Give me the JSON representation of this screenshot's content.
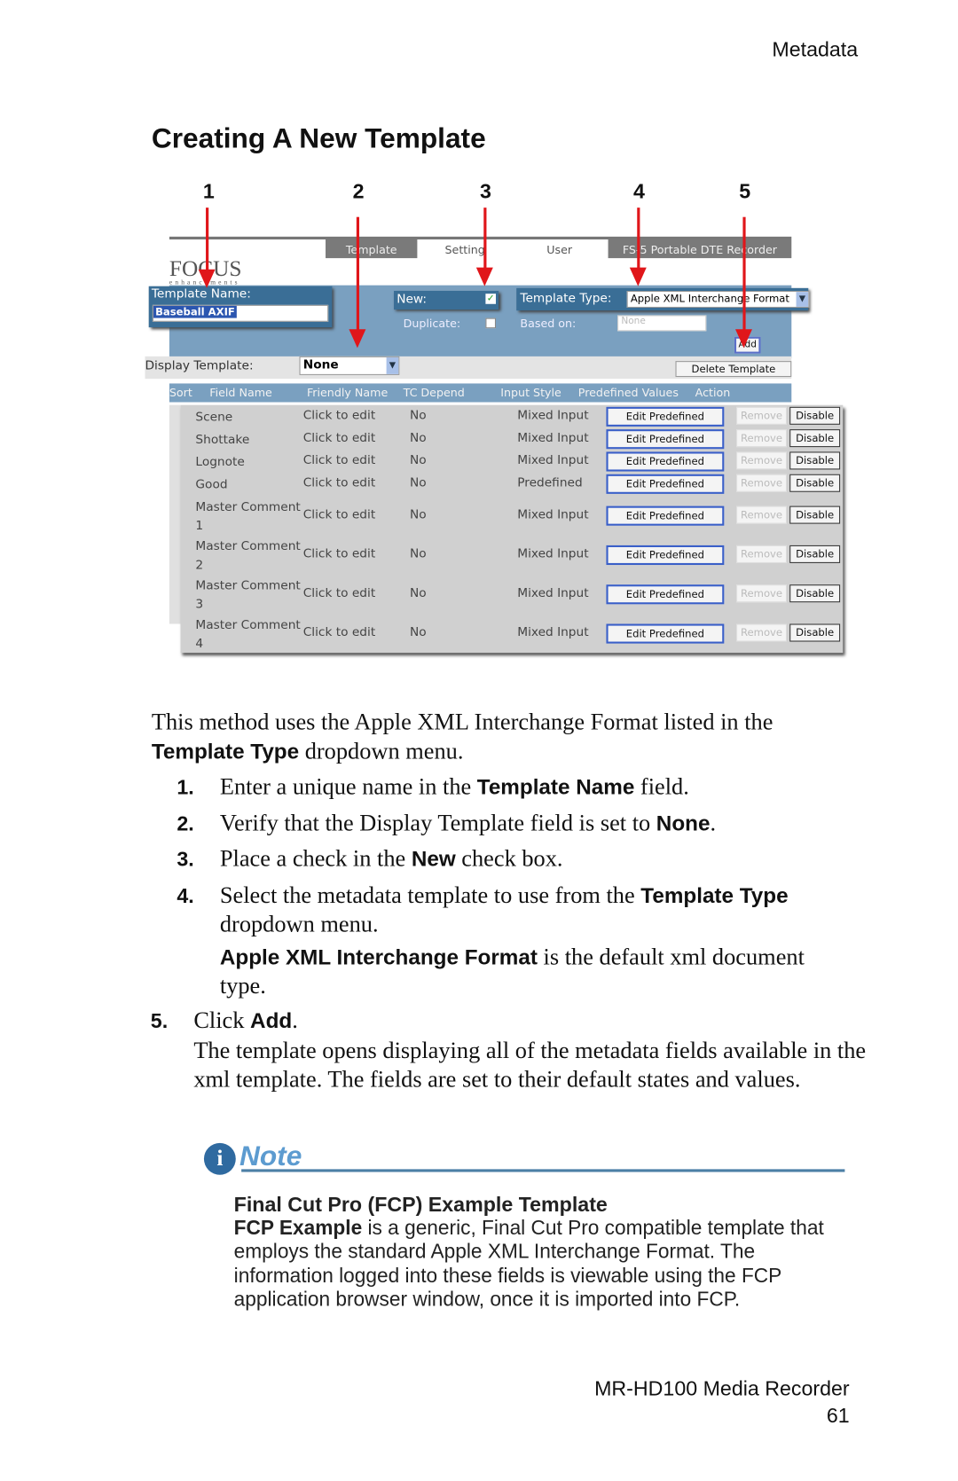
{
  "header": {
    "section": "Metadata"
  },
  "title": "Creating A New Template",
  "callouts": [
    "1",
    "2",
    "3",
    "4",
    "5"
  ],
  "screenshot": {
    "tabs": [
      "Template",
      "Setting",
      "User",
      "FS-5 Portable DTE Recorder"
    ],
    "logo": "FOCUS",
    "logo_sub": "enhancements",
    "template_name_label": "Template Name:",
    "template_name_value": "Baseball AXIF",
    "new_label": "New:",
    "new_checked": true,
    "duplicate_label": "Duplicate:",
    "duplicate_checked": false,
    "template_type_label": "Template Type:",
    "template_type_value": "Apple XML Interchange Format",
    "based_on_label": "Based on:",
    "based_on_value": "None",
    "add_button": "Add",
    "display_template_label": "Display Template:",
    "display_template_value": "None",
    "delete_button": "Delete Template",
    "columns": [
      "Sort",
      "Field Name",
      "Friendly Name",
      "TC Depend",
      "Input Style",
      "Predefined Values",
      "Action"
    ],
    "rows": [
      {
        "field": "Scene",
        "friendly": "Click to edit",
        "tc": "No",
        "style": "Mixed Input"
      },
      {
        "field": "Shottake",
        "friendly": "Click to edit",
        "tc": "No",
        "style": "Mixed Input"
      },
      {
        "field": "Lognote",
        "friendly": "Click to edit",
        "tc": "No",
        "style": "Mixed Input"
      },
      {
        "field": "Good",
        "friendly": "Click to edit",
        "tc": "No",
        "style": "Predefined"
      },
      {
        "field": "Master Comment 1",
        "friendly": "Click to edit",
        "tc": "No",
        "style": "Mixed Input"
      },
      {
        "field": "Master Comment 2",
        "friendly": "Click to edit",
        "tc": "No",
        "style": "Mixed Input"
      },
      {
        "field": "Master Comment 3",
        "friendly": "Click to edit",
        "tc": "No",
        "style": "Mixed Input"
      },
      {
        "field": "Master Comment 4",
        "friendly": "Click to edit",
        "tc": "No",
        "style": "Mixed Input"
      }
    ],
    "edit_predefined": "Edit Predefined",
    "remove": "Remove",
    "disable": "Disable"
  },
  "intro": {
    "a": "This method uses the Apple XML Interchange Format listed in the ",
    "b": "Template Type",
    "c": " dropdown menu."
  },
  "steps": [
    {
      "n": "1.",
      "a": "Enter a unique name in the ",
      "b": "Template Name",
      "c": " field."
    },
    {
      "n": "2.",
      "a": "Verify that the Display Template field is set to ",
      "b": "None",
      "c": "."
    },
    {
      "n": "3.",
      "a": "Place a check in the ",
      "b": "New",
      "c": " check box."
    },
    {
      "n": "4.",
      "a": "Select the metadata template to use from the ",
      "b": "Template Type",
      "c": " dropdown menu."
    },
    {
      "n": "5.",
      "a": "Click ",
      "b": "Add",
      "c": "."
    }
  ],
  "step4_note": {
    "b": "Apple XML Interchange Format",
    "c": " is the default xml document type."
  },
  "step5_note": "The template opens displaying all of the metadata fields available in the xml template. The fields are set to their default states and values.",
  "note": {
    "label": "Note",
    "heading": "Final Cut Pro (FCP) Example Template",
    "b": "FCP Example",
    "text": " is a generic, Final Cut Pro compatible template that employs the standard Apple XML Interchange Format. The information logged into these fields is viewable using the FCP application browser window, once it is imported into FCP."
  },
  "footer": {
    "product": "MR-HD100 Media Recorder",
    "page": "61"
  }
}
